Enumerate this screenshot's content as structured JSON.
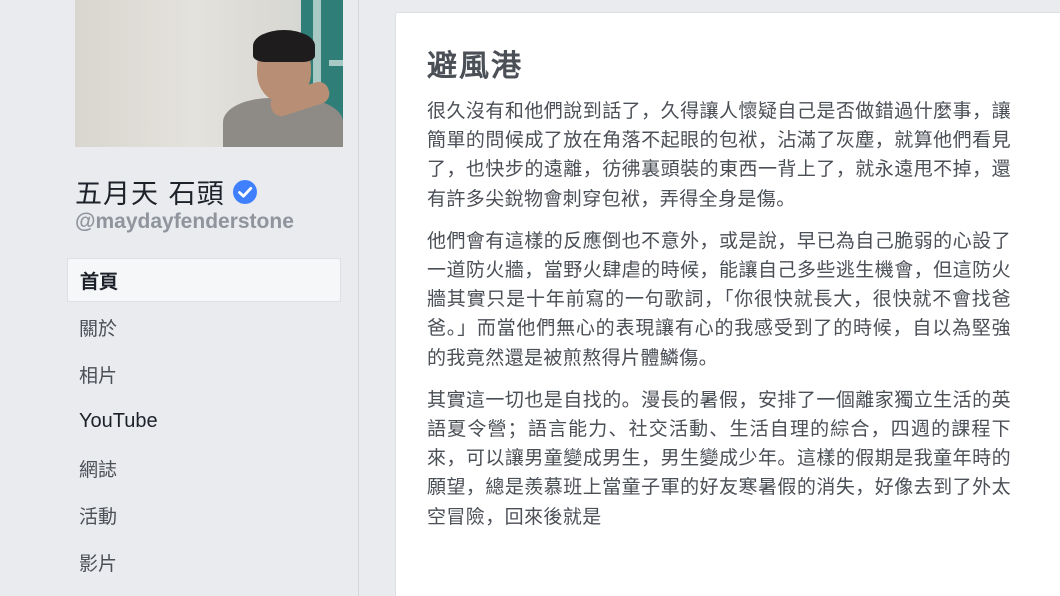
{
  "sidebar": {
    "page_name": "五月天 石頭",
    "handle": "@maydayfenderstone",
    "verified_color": "#4080ff",
    "nav": [
      {
        "label": "首頁",
        "active": true
      },
      {
        "label": "關於"
      },
      {
        "label": "相片"
      },
      {
        "label": "YouTube"
      },
      {
        "label": "網誌"
      },
      {
        "label": "活動"
      },
      {
        "label": "影片"
      }
    ]
  },
  "note": {
    "title": "避風港",
    "paragraphs": [
      "很久沒有和他們說到話了，久得讓人懷疑自己是否做錯過什麼事，讓簡單的問候成了放在角落不起眼的包袱，沾滿了灰塵，就算他們看見了，也快步的遠離，彷彿裏頭裝的東西一背上了，就永遠甩不掉，還有許多尖銳物會刺穿包袱，弄得全身是傷。",
      "他們會有這樣的反應倒也不意外，或是說，早已為自己脆弱的心設了一道防火牆，當野火肆虐的時候，能讓自己多些逃生機會，但這防火牆其實只是十年前寫的一句歌詞，「你很快就長大，很快就不會找爸爸。」而當他們無心的表現讓有心的我感受到了的時候，自以為堅強的我竟然還是被煎熬得片體鱗傷。",
      "其實這一切也是自找的。漫長的暑假，安排了一個離家獨立生活的英語夏令營；語言能力、社交活動、生活自理的綜合，四週的課程下來，可以讓男童變成男生，男生變成少年。這樣的假期是我童年時的願望，總是羨慕班上當童子軍的好友寒暑假的消失，好像去到了外太空冒險，回來後就是"
    ]
  }
}
